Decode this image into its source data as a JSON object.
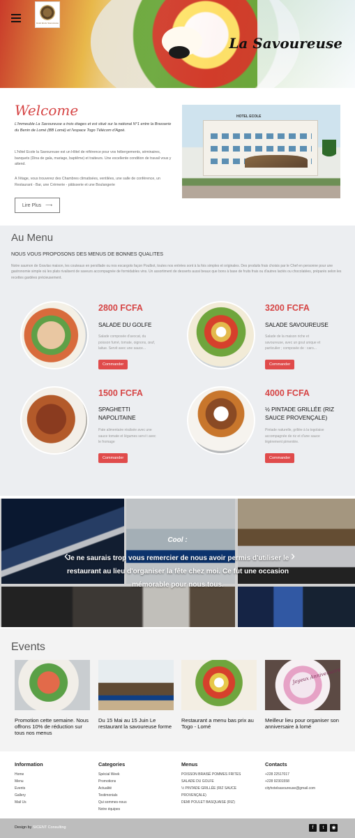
{
  "header": {
    "brand": "La Savoureuse",
    "logo_text": "Hotel Ecole Savoureuse"
  },
  "welcome": {
    "title": "Welcome",
    "lead": "L'Immeuble La Savoureuse a trois étages et est situé sur la national N°1 entre la Brasserie du Benin de Lomé (BB Lomé) et l'espace Togo Télécom d'Agoè.",
    "p1": "L'hôtel Ecole la Savoureuse est un Hôtel de référence pour vos hébergements, séminaires, banquets (Dina de gala, mariage, baptême) et traiteurs. Une excellente condition de travail vous y attend.",
    "p2": "A l'étage, vous trouverez des Chambres climatisées, ventilées, une salle de conférence, un Restaurant - Bar, une Crèmerie - pâtisserie et une Boulangerie",
    "read_more": "Lire Plus",
    "hotel_sign": "HOTEL ECOLE"
  },
  "menu": {
    "title": "Au Menu",
    "subtitle": "NOUS VOUS PROPOSONS DES MENUS DE BONNES QUALITES",
    "description": "Notre saumon de Gravlax maison, les couteaux en persillade ou nos escargots façon Poulbot, toutes nos entrées sont à la fois simples et originales. Des produits frais choisis par le Chef en personne pour une gastronomie simple où les plats rivalisent de saveurs accompagnée de formidables vins. Un assortiment de desserts aussi beaux que bons à base de fruits frais ou d'autres lactés ou chocolatées, préparés selon les recettes gardées précieusement.",
    "order_label": "Commander",
    "dishes": [
      {
        "price": "2800 FCFA",
        "name": "SALADE DU GOLFE",
        "desc": "Salade composée d'avocat, du poisson fumé, tomate, oignons, œuf, laitue. Servit avec une sauce..."
      },
      {
        "price": "3200 FCFA",
        "name": "SALADE SAVOUREUSE",
        "desc": "Salade de la maison riche et savoureuse, avec un gout unique et particulier ; composée de : caro..."
      },
      {
        "price": "1500 FCFA",
        "name": "SPAGHETTI NAPOLITAINE",
        "desc": "Pate alimentaire réalisée avec une sauce tomate et légumes servi t avec le fromage"
      },
      {
        "price": "4000 FCFA",
        "name": "½ PINTADE GRILLÉE (RIZ SAUCE PROVENÇALE)",
        "desc": "Pintade naturelle, grillée à la togolaise accompagnée de riz et d'une sauce légèrement pimentée."
      }
    ]
  },
  "testimonial": {
    "author": "Cool :",
    "quote": "Je ne saurais trop vous remercier de nous avoir permis d'utiliser le restaurant au lieu d'organiser la fête chez moi. Ce fut une occasion mémorable pour nous tous."
  },
  "events": {
    "title": "Events",
    "items": [
      {
        "caption": "Promotion cette semaine. Nous offrons 10% de réduction sur tous nos menus"
      },
      {
        "caption": "Du 15 Mai au 15 Juin Le restaurant la savoureuse forme"
      },
      {
        "caption": "Restaurant a menu bas prix au Togo - Lomé"
      },
      {
        "caption": "Meilleur lieu pour organiser son anniversaire à lomé"
      }
    ],
    "cake_text": "Joyeux Anniversaire"
  },
  "footer": {
    "information": {
      "title": "Information",
      "items": [
        "Home",
        "Menu",
        "Events",
        "Gallery",
        "Mail Us"
      ]
    },
    "categories": {
      "title": "Categories",
      "items": [
        "Spécial Week",
        "Promotions",
        "Actualité",
        "Testimonials",
        "Qui sommes-nous",
        "Notre équipes"
      ]
    },
    "menus": {
      "title": "Menus",
      "items": [
        "POISSON BRAISÉ POMMES FRITES",
        "SALADE DU GOLFE",
        "½ PINTADE GRILLÉE (RIZ SAUCE PROVENÇALE)",
        "DEMI POULET BASQUAISE (RIZ)"
      ]
    },
    "contacts": {
      "title": "Contacts",
      "items": [
        "+228 22517017",
        "+228 92301558",
        "cityhotelsavoureuse@gmail.com"
      ]
    },
    "credit_prefix": "Design by",
    "credit_name": "SICENT Consulting"
  },
  "icons": {
    "menu": "hamburger-icon",
    "read_more_arrow": "arrow-right-icon",
    "prev": "chevron-left-icon",
    "next": "chevron-right-icon",
    "social": [
      "facebook-icon",
      "twitter-icon",
      "rss-icon"
    ]
  },
  "colors": {
    "accent": "#d64545",
    "button": "#e04b4b",
    "menu_bg": "#eceef1",
    "footer_bar": "#bdbdbd"
  }
}
